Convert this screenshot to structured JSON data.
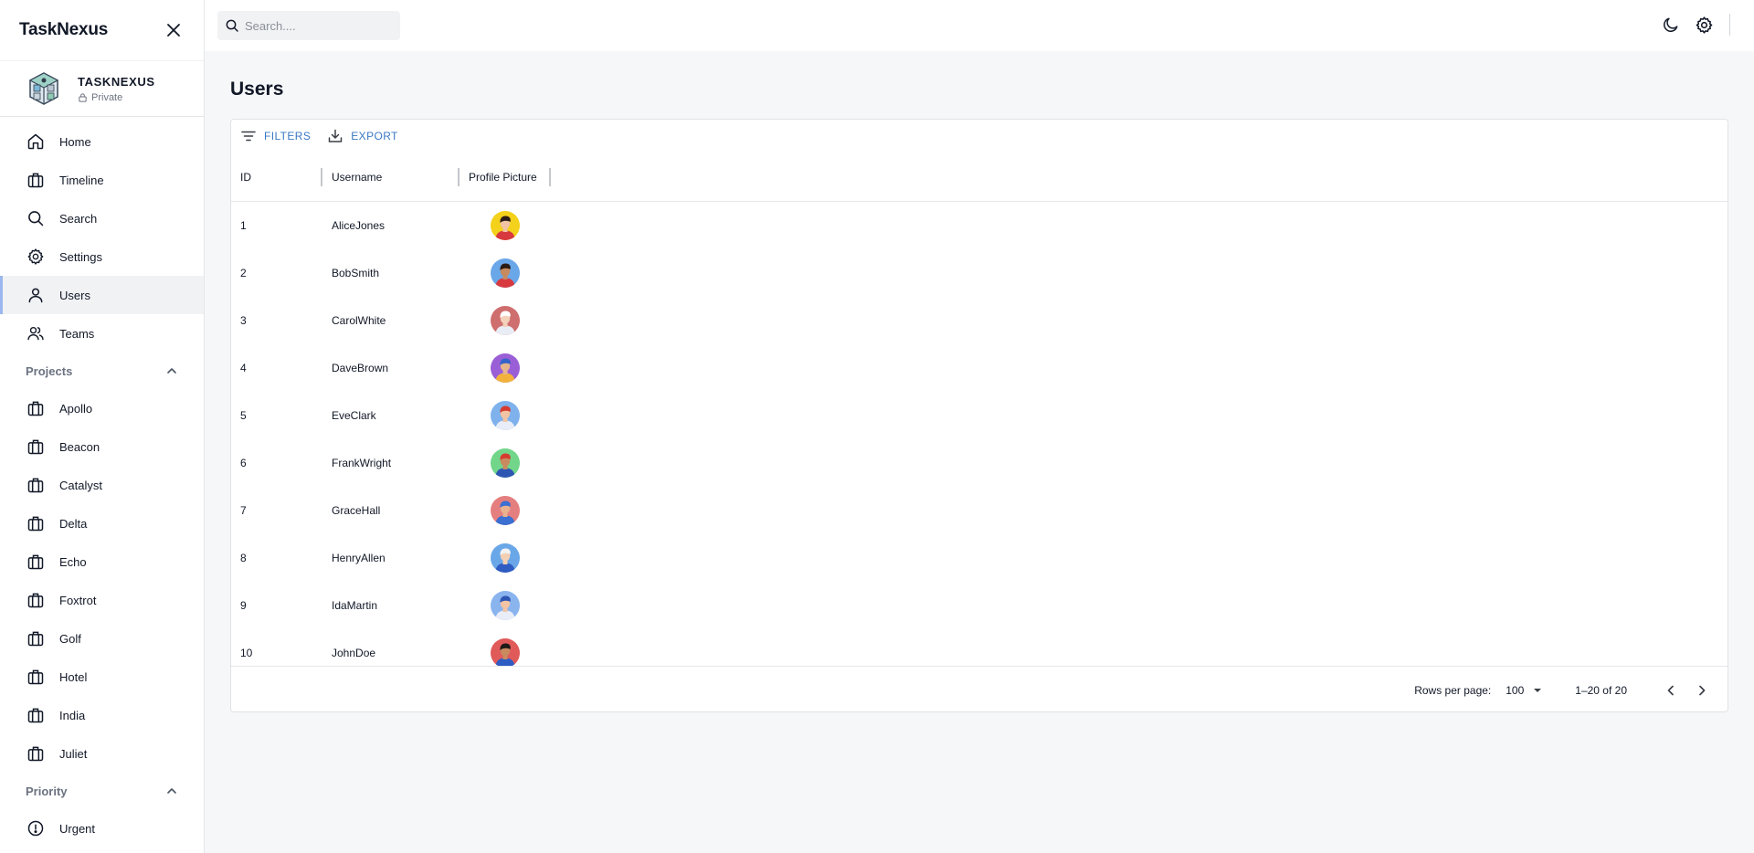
{
  "app": {
    "title": "TaskNexus"
  },
  "workspace": {
    "name": "TASKNEXUS",
    "visibility": "Private"
  },
  "nav": [
    {
      "label": "Home",
      "icon": "home-icon"
    },
    {
      "label": "Timeline",
      "icon": "briefcase-icon"
    },
    {
      "label": "Search",
      "icon": "search-icon"
    },
    {
      "label": "Settings",
      "icon": "gear-icon"
    },
    {
      "label": "Users",
      "icon": "user-icon",
      "active": true
    },
    {
      "label": "Teams",
      "icon": "users-icon"
    }
  ],
  "projects": {
    "label": "Projects",
    "items": [
      "Apollo",
      "Beacon",
      "Catalyst",
      "Delta",
      "Echo",
      "Foxtrot",
      "Golf",
      "Hotel",
      "India",
      "Juliet"
    ]
  },
  "priority": {
    "label": "Priority",
    "items": [
      "Urgent"
    ]
  },
  "search": {
    "placeholder": "Search...."
  },
  "page": {
    "title": "Users"
  },
  "toolbar": {
    "filters": "FILTERS",
    "export": "EXPORT"
  },
  "table": {
    "columns": [
      "ID",
      "Username",
      "Profile Picture"
    ],
    "rows": [
      {
        "id": "1",
        "username": "AliceJones",
        "avatar": {
          "bg": "#f4d11a",
          "skin": "#f2c4a4",
          "hair": "#2b1d16",
          "shirt": "#d8393f"
        }
      },
      {
        "id": "2",
        "username": "BobSmith",
        "avatar": {
          "bg": "#6aa7e8",
          "skin": "#c68a5e",
          "hair": "#2a1a12",
          "shirt": "#d8393f"
        }
      },
      {
        "id": "3",
        "username": "CarolWhite",
        "avatar": {
          "bg": "#cf6e6e",
          "skin": "#f3d1bb",
          "hair": "#ffffff",
          "shirt": "#e9edf5"
        }
      },
      {
        "id": "4",
        "username": "DaveBrown",
        "avatar": {
          "bg": "#9a5fd6",
          "skin": "#e7b58d",
          "hair": "#3563c9",
          "shirt": "#f2b23c"
        }
      },
      {
        "id": "5",
        "username": "EveClark",
        "avatar": {
          "bg": "#7fb2ec",
          "skin": "#f2c4a4",
          "hair": "#d63b2f",
          "shirt": "#e8edf7"
        }
      },
      {
        "id": "6",
        "username": "FrankWright",
        "avatar": {
          "bg": "#72d68a",
          "skin": "#c98a5f",
          "hair": "#d63b2f",
          "shirt": "#2d56b3"
        }
      },
      {
        "id": "7",
        "username": "GraceHall",
        "avatar": {
          "bg": "#e57f7f",
          "skin": "#e9b28e",
          "hair": "#3b6fd1",
          "shirt": "#3b6fd1"
        }
      },
      {
        "id": "8",
        "username": "HenryAllen",
        "avatar": {
          "bg": "#6aa7e8",
          "skin": "#f3cfb3",
          "hair": "#f2f2f2",
          "shirt": "#2f5cc2"
        }
      },
      {
        "id": "9",
        "username": "IdaMartin",
        "avatar": {
          "bg": "#8ab4ee",
          "skin": "#f2c4a4",
          "hair": "#2d56b3",
          "shirt": "#e8edf7"
        }
      },
      {
        "id": "10",
        "username": "JohnDoe",
        "avatar": {
          "bg": "#e05a5a",
          "skin": "#c98a5f",
          "hair": "#1d1a18",
          "shirt": "#2f5cc2"
        }
      }
    ]
  },
  "footer": {
    "rows_per_page_label": "Rows per page:",
    "rows_per_page_value": "100",
    "range": "1–20 of 20"
  },
  "colors": {
    "accent": "#3b78c4",
    "active_indicator": "#9bb8ee"
  }
}
